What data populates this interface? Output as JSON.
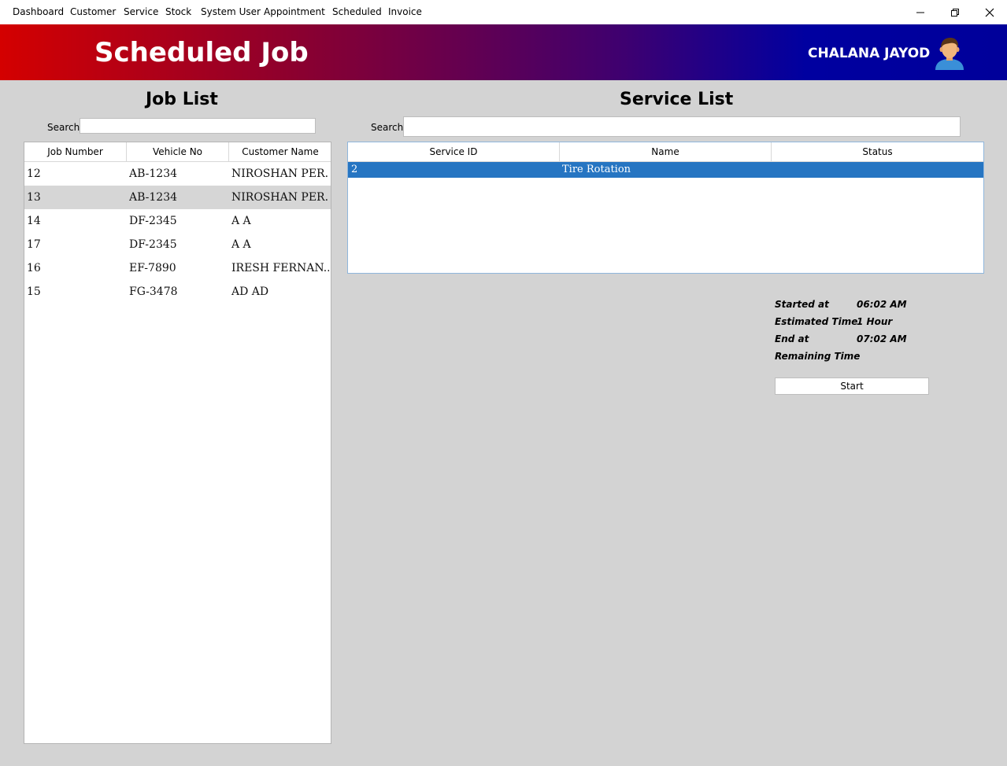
{
  "menu": {
    "items": [
      "Dashboard",
      "Customer",
      "Service",
      "Stock",
      "System User",
      "Appointment",
      "Scheduled",
      "Invoice"
    ],
    "window_controls": {
      "minimize": "—",
      "restore": "❐",
      "close": "✕"
    }
  },
  "header": {
    "title": "Scheduled Job",
    "user_name": "CHALANA JAYOD",
    "colors": {
      "gradient_start": "#d40000",
      "gradient_end": "#00009a"
    }
  },
  "job_list": {
    "title": "Job List",
    "search_label": "Search",
    "search_value": "",
    "columns": [
      "Job Number",
      "Vehicle No",
      "Customer Name"
    ],
    "rows": [
      {
        "job": "12",
        "vehicle": "AB-1234",
        "customer": "NIROSHAN PER..."
      },
      {
        "job": "13",
        "vehicle": "AB-1234",
        "customer": "NIROSHAN PER..."
      },
      {
        "job": "14",
        "vehicle": "DF-2345",
        "customer": "A A"
      },
      {
        "job": "17",
        "vehicle": "DF-2345",
        "customer": "A A"
      },
      {
        "job": "16",
        "vehicle": "EF-7890",
        "customer": "IRESH FERNAN..."
      },
      {
        "job": "15",
        "vehicle": "FG-3478",
        "customer": "AD AD"
      }
    ]
  },
  "service_list": {
    "title": "Service List",
    "search_label": "Search",
    "search_value": "",
    "columns": [
      "Service ID",
      "Name",
      "Status"
    ],
    "rows": [
      {
        "id": "2",
        "name": "Tire Rotation",
        "status": ""
      }
    ],
    "selection_color": "#2675c2"
  },
  "timing": {
    "started_label": "Started at",
    "started_value": "06:02 AM",
    "estimated_label": "Estimated Time",
    "estimated_value": "1 Hour",
    "end_label": "End at",
    "end_value": "07:02 AM",
    "remaining_label": "Remaining Time",
    "remaining_value": "",
    "start_button": "Start"
  }
}
